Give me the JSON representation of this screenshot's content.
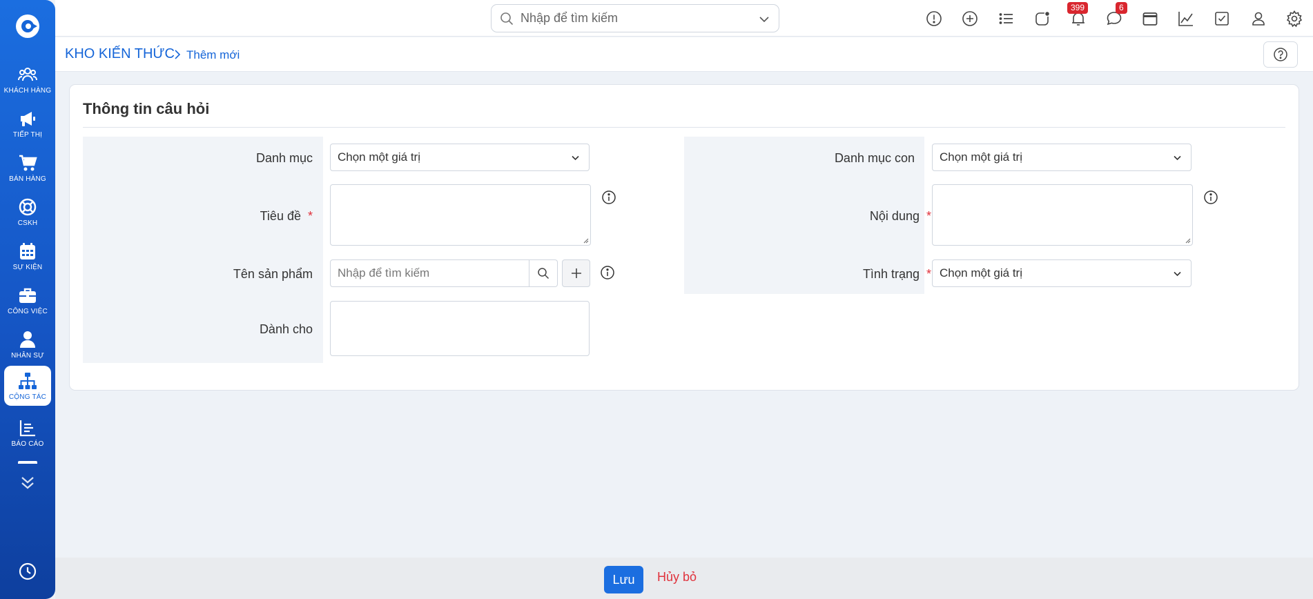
{
  "sidebar": {
    "items": [
      {
        "label": "KHÁCH HÀNG",
        "icon": "users-icon"
      },
      {
        "label": "TIẾP THỊ",
        "icon": "megaphone-icon"
      },
      {
        "label": "BÁN HÀNG",
        "icon": "cart-icon"
      },
      {
        "label": "CSKH",
        "icon": "lifebuoy-icon"
      },
      {
        "label": "SỰ KIỆN",
        "icon": "calendar-icon"
      },
      {
        "label": "CÔNG VIỆC",
        "icon": "briefcase-icon"
      },
      {
        "label": "NHÂN SỰ",
        "icon": "person-icon"
      },
      {
        "label": "CỘNG TÁC",
        "icon": "org-chart-icon",
        "active": true
      },
      {
        "label": "BÁO CÁO",
        "icon": "report-icon"
      }
    ]
  },
  "topbar": {
    "search_placeholder": "Nhập để tìm kiếm",
    "notifications_count": "399",
    "messages_count": "6"
  },
  "breadcrumb": {
    "root": "KHO KIẾN THỨC",
    "current": "Thêm mới"
  },
  "form": {
    "title": "Thông tin câu hỏi",
    "category_label": "Danh mục",
    "category_value": "Chọn một giá trị",
    "title_label": "Tiêu đề",
    "product_label": "Tên sản phẩm",
    "product_placeholder": "Nhập để tìm kiếm",
    "audience_label": "Dành cho",
    "subcategory_label": "Danh mục con",
    "subcategory_value": "Chọn một giá trị",
    "content_label": "Nội dung",
    "status_label": "Tình trạng",
    "status_value": "Chọn một giá trị",
    "required_mark": "*"
  },
  "footer": {
    "save_label": "Lưu",
    "cancel_label": "Hủy bỏ"
  },
  "colors": {
    "primary": "#1b6ee0",
    "danger": "#e0313b",
    "badge": "#d9262e"
  }
}
